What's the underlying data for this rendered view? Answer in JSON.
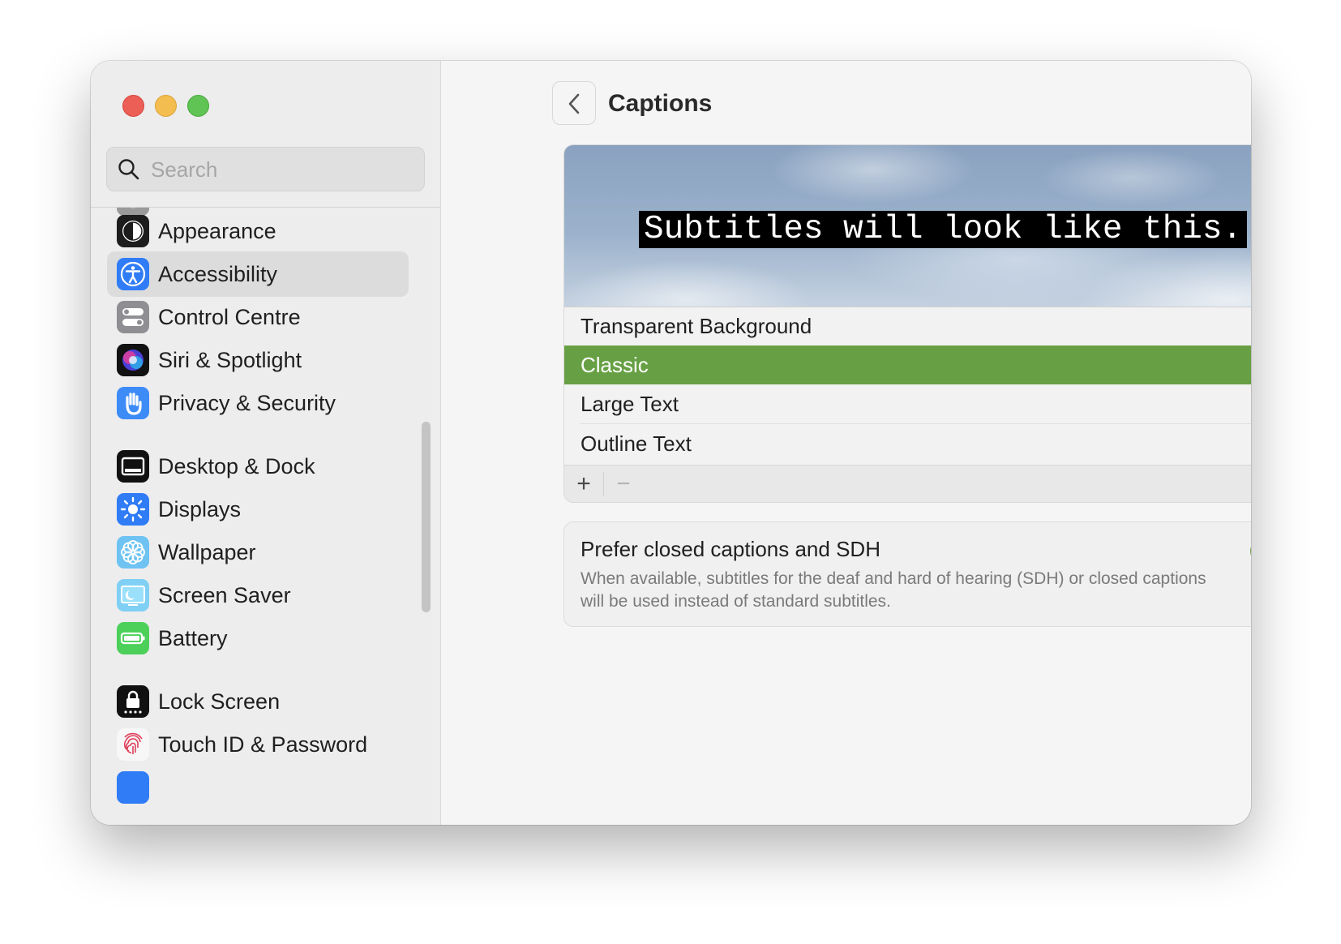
{
  "window": {
    "traffic_lights": [
      "close",
      "minimize",
      "zoom"
    ]
  },
  "sidebar": {
    "search_placeholder": "Search",
    "items": [
      {
        "label": "Appearance",
        "icon": "appearance-icon",
        "selected": false
      },
      {
        "label": "Accessibility",
        "icon": "accessibility-icon",
        "selected": true
      },
      {
        "label": "Control Centre",
        "icon": "control-centre-icon",
        "selected": false
      },
      {
        "label": "Siri & Spotlight",
        "icon": "siri-icon",
        "selected": false
      },
      {
        "label": "Privacy & Security",
        "icon": "hand-icon",
        "selected": false
      },
      {
        "label": "Desktop & Dock",
        "icon": "dock-icon",
        "selected": false
      },
      {
        "label": "Displays",
        "icon": "sun-icon",
        "selected": false
      },
      {
        "label": "Wallpaper",
        "icon": "flower-icon",
        "selected": false
      },
      {
        "label": "Screen Saver",
        "icon": "screen-saver-icon",
        "selected": false
      },
      {
        "label": "Battery",
        "icon": "battery-icon",
        "selected": false
      },
      {
        "label": "Lock Screen",
        "icon": "lock-icon",
        "selected": false
      },
      {
        "label": "Touch ID & Password",
        "icon": "fingerprint-icon",
        "selected": false
      }
    ]
  },
  "header": {
    "title": "Captions"
  },
  "preview": {
    "sample_text": "Subtitles will look like this."
  },
  "caption_styles": {
    "items": [
      "Transparent Background",
      "Classic",
      "Large Text",
      "Outline Text"
    ],
    "selected": "Classic",
    "add_label": "+",
    "remove_label": "−"
  },
  "sdh": {
    "title": "Prefer closed captions and SDH",
    "description": "When available, subtitles for the deaf and hard of hearing (SDH) or closed captions will be used instead of standard subtitles.",
    "enabled": true
  },
  "help_label": "?",
  "colors": {
    "accent_green": "#67a044",
    "close": "#ec5f57",
    "minimize": "#f4bd4f",
    "zoom": "#5fc454"
  }
}
